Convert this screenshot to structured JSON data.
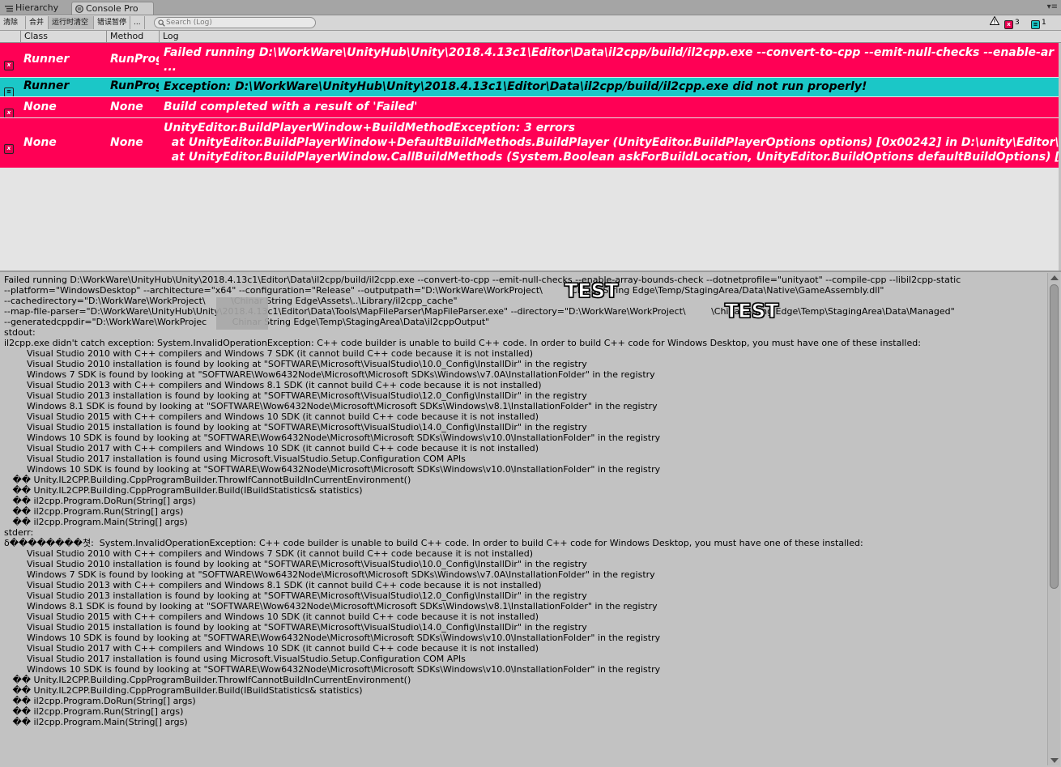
{
  "tabs": {
    "hierarchy": "Hierarchy",
    "console": "Console Pro",
    "hierarchy_icon": "list-icon",
    "console_icon": "console-icon"
  },
  "toolbar": {
    "buttons": [
      "清除",
      "合并",
      "运行时清空",
      "错误暂停",
      "..."
    ],
    "search_placeholder": "Search (Log)",
    "warning_icon": "warning-triangle-icon",
    "error_count": "3",
    "log_count": "1"
  },
  "columns": {
    "class": "Class",
    "method": "Method",
    "log": "Log"
  },
  "colors": {
    "error_row": "#ff0055",
    "log_row": "#1bc7c7"
  },
  "rows": [
    {
      "type": "error",
      "class": "Runner",
      "method": "RunProgram",
      "log": "Failed running D:\\WorkWare\\UnityHub\\Unity\\2018.4.13c1\\Editor\\Data\\il2cpp/build/il2cpp.exe --convert-to-cpp --emit-null-checks --enable-ar\n..."
    },
    {
      "type": "log",
      "class": "Runner",
      "method": "RunProgram",
      "log": "Exception: D:\\WorkWare\\UnityHub\\Unity\\2018.4.13c1\\Editor\\Data\\il2cpp/build/il2cpp.exe did not run properly!"
    },
    {
      "type": "error",
      "class": "None",
      "method": "None",
      "log": "Build completed with a result of 'Failed'"
    },
    {
      "type": "error",
      "class": "None",
      "method": "None",
      "log": "UnityEditor.BuildPlayerWindow+BuildMethodException: 3 errors\n  at UnityEditor.BuildPlayerWindow+DefaultBuildMethods.BuildPlayer (UnityEditor.BuildPlayerOptions options) [0x00242] in D:\\unity\\Editor\\Mo\n  at UnityEditor.BuildPlayerWindow.CallBuildMethods (System.Boolean askForBuildLocation, UnityEditor.BuildOptions defaultBuildOptions) [0x0007"
    }
  ],
  "detail": "Failed running D:\\WorkWare\\UnityHub\\Unity\\2018.4.13c1\\Editor\\Data\\il2cpp/build/il2cpp.exe --convert-to-cpp --emit-null-checks --enable-array-bounds-check --dotnetprofile=\"unityaot\" --compile-cpp --libil2cpp-static\n--platform=\"WindowsDesktop\" --architecture=\"x64\" --configuration=\"Release\" --outputpath=\"D:\\WorkWare\\WorkProject\\         \\Chinar String Edge\\Temp/StagingArea/Data\\Native\\GameAssembly.dll\"\n--cachedirectory=\"D:\\WorkWare\\WorkProject\\         \\Chinar String Edge\\Assets\\..\\Library/il2cpp_cache\"\n--map-file-parser=\"D:\\WorkWare\\UnityHub\\Unity\\2018.4.13c1\\Editor\\Data\\Tools\\MapFileParser\\MapFileParser.exe\" --directory=\"D:\\WorkWare\\WorkProject\\         \\Chinar String Edge\\Temp\\StagingArea\\Data\\Managed\"\n--generatedcppdir=\"D:\\WorkWare\\WorkProjec         Chinar String Edge\\Temp\\StagingArea\\Data\\il2cppOutput\"\nstdout:\nil2cpp.exe didn't catch exception: System.InvalidOperationException: C++ code builder is unable to build C++ code. In order to build C++ code for Windows Desktop, you must have one of these installed:\n        Visual Studio 2010 with C++ compilers and Windows 7 SDK (it cannot build C++ code because it is not installed)\n        Visual Studio 2010 installation is found by looking at \"SOFTWARE\\Microsoft\\VisualStudio\\10.0_Config\\InstallDir\" in the registry\n        Windows 7 SDK is found by looking at \"SOFTWARE\\Wow6432Node\\Microsoft\\Microsoft SDKs\\Windows\\v7.0A\\InstallationFolder\" in the registry\n        Visual Studio 2013 with C++ compilers and Windows 8.1 SDK (it cannot build C++ code because it is not installed)\n        Visual Studio 2013 installation is found by looking at \"SOFTWARE\\Microsoft\\VisualStudio\\12.0_Config\\InstallDir\" in the registry\n        Windows 8.1 SDK is found by looking at \"SOFTWARE\\Wow6432Node\\Microsoft\\Microsoft SDKs\\Windows\\v8.1\\InstallationFolder\" in the registry\n        Visual Studio 2015 with C++ compilers and Windows 10 SDK (it cannot build C++ code because it is not installed)\n        Visual Studio 2015 installation is found by looking at \"SOFTWARE\\Microsoft\\VisualStudio\\14.0_Config\\InstallDir\" in the registry\n        Windows 10 SDK is found by looking at \"SOFTWARE\\Wow6432Node\\Microsoft\\Microsoft SDKs\\Windows\\v10.0\\InstallationFolder\" in the registry\n        Visual Studio 2017 with C++ compilers and Windows 10 SDK (it cannot build C++ code because it is not installed)\n        Visual Studio 2017 installation is found using Microsoft.VisualStudio.Setup.Configuration COM APIs\n        Windows 10 SDK is found by looking at \"SOFTWARE\\Wow6432Node\\Microsoft\\Microsoft SDKs\\Windows\\v10.0\\InstallationFolder\" in the registry\n   �� Unity.IL2CPP.Building.CppProgramBuilder.ThrowIfCannotBuildInCurrentEnvironment()\n   �� Unity.IL2CPP.Building.CppProgramBuilder.Build(IBuildStatistics& statistics)\n   �� il2cpp.Program.DoRun(String[] args)\n   �� il2cpp.Program.Run(String[] args)\n   �� il2cpp.Program.Main(String[] args)\nstderr:\nδ��������쳣:  System.InvalidOperationException: C++ code builder is unable to build C++ code. In order to build C++ code for Windows Desktop, you must have one of these installed:\n        Visual Studio 2010 with C++ compilers and Windows 7 SDK (it cannot build C++ code because it is not installed)\n        Visual Studio 2010 installation is found by looking at \"SOFTWARE\\Microsoft\\VisualStudio\\10.0_Config\\InstallDir\" in the registry\n        Windows 7 SDK is found by looking at \"SOFTWARE\\Wow6432Node\\Microsoft\\Microsoft SDKs\\Windows\\v7.0A\\InstallationFolder\" in the registry\n        Visual Studio 2013 with C++ compilers and Windows 8.1 SDK (it cannot build C++ code because it is not installed)\n        Visual Studio 2013 installation is found by looking at \"SOFTWARE\\Microsoft\\VisualStudio\\12.0_Config\\InstallDir\" in the registry\n        Windows 8.1 SDK is found by looking at \"SOFTWARE\\Wow6432Node\\Microsoft\\Microsoft SDKs\\Windows\\v8.1\\InstallationFolder\" in the registry\n        Visual Studio 2015 with C++ compilers and Windows 10 SDK (it cannot build C++ code because it is not installed)\n        Visual Studio 2015 installation is found by looking at \"SOFTWARE\\Microsoft\\VisualStudio\\14.0_Config\\InstallDir\" in the registry\n        Windows 10 SDK is found by looking at \"SOFTWARE\\Wow6432Node\\Microsoft\\Microsoft SDKs\\Windows\\v10.0\\InstallationFolder\" in the registry\n        Visual Studio 2017 with C++ compilers and Windows 10 SDK (it cannot build C++ code because it is not installed)\n        Visual Studio 2017 installation is found using Microsoft.VisualStudio.Setup.Configuration COM APIs\n        Windows 10 SDK is found by looking at \"SOFTWARE\\Wow6432Node\\Microsoft\\Microsoft SDKs\\Windows\\v10.0\\InstallationFolder\" in the registry\n   �� Unity.IL2CPP.Building.CppProgramBuilder.ThrowIfCannotBuildInCurrentEnvironment()\n   �� Unity.IL2CPP.Building.CppProgramBuilder.Build(IBuildStatistics& statistics)\n   �� il2cpp.Program.DoRun(String[] args)\n   �� il2cpp.Program.Run(String[] args)\n   �� il2cpp.Program.Main(String[] args)",
  "overlay_labels": [
    "TEST",
    "TEST"
  ]
}
